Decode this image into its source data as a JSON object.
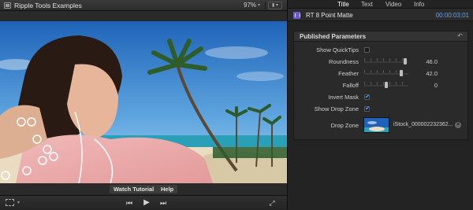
{
  "viewer": {
    "title": "Ripple Tools Examples",
    "zoom": "97%",
    "zoom_caret": "▾",
    "view_switch": "▮ ▾",
    "overlay_buttons": {
      "watch": "Watch Tutorial",
      "help": "Help"
    },
    "transport": {
      "prev": "⏮",
      "play": "▶",
      "next": "⏭",
      "fullscreen": "⤢",
      "view_caret": "▾"
    }
  },
  "inspector": {
    "tabs": [
      "Title",
      "Text",
      "Video",
      "Info"
    ],
    "active_tab": "Title",
    "clip_name": "RT 8 Point Matte",
    "timecode": "00:00:03;01",
    "panel_title": "Published Parameters",
    "reset_glyph": "↶",
    "params": {
      "show_quicktips": {
        "label": "Show QuickTips",
        "checked": false
      },
      "roundness": {
        "label": "Roundness",
        "value": "46.0",
        "fraction": 0.92
      },
      "feather": {
        "label": "Feather",
        "value": "42.0",
        "fraction": 0.84
      },
      "falloff": {
        "label": "Falloff",
        "value": "0",
        "fraction": 0.5
      },
      "invert_mask": {
        "label": "Invert Mask",
        "checked": true,
        "glyph": "✔"
      },
      "show_drop_zone": {
        "label": "Show Drop Zone",
        "checked": true,
        "glyph": "✔"
      },
      "drop_zone": {
        "label": "Drop Zone",
        "file": "iStock_000002232362...",
        "clear_glyph": "×"
      }
    }
  },
  "colors": {
    "accent_blue": "#4d95ff",
    "timecode_blue": "#6aa3e8",
    "clip_icon": "#6a5ad8"
  },
  "icons": [
    "viewer-icon",
    "clip-icon",
    "reset-icon",
    "checkbox-icon",
    "clear-icon",
    "play-icon",
    "prev-icon",
    "next-icon",
    "fullscreen-icon"
  ]
}
